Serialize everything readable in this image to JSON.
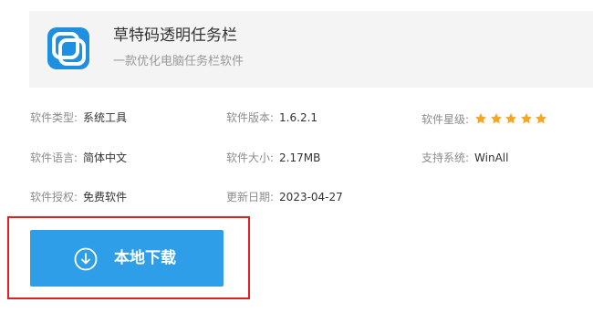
{
  "app": {
    "name": "草特码透明任务栏",
    "description": "一款优化电脑任务栏软件"
  },
  "info": {
    "type": {
      "label": "软件类型:",
      "value": "系统工具"
    },
    "version": {
      "label": "软件版本:",
      "value": "1.6.2.1"
    },
    "rating": {
      "label": "软件星级:",
      "stars": 5
    },
    "language": {
      "label": "软件语言:",
      "value": "简体中文"
    },
    "size": {
      "label": "软件大小:",
      "value": "2.17MB"
    },
    "platform": {
      "label": "支持系统:",
      "value": "WinAll"
    },
    "license": {
      "label": "软件授权:",
      "value": "免费软件"
    },
    "updated": {
      "label": "更新日期:",
      "value": "2023-04-27"
    }
  },
  "download": {
    "label": "本地下载"
  },
  "colors": {
    "accent": "#2e9ee8",
    "star": "#f5a623",
    "highlight_border": "#e02020"
  }
}
